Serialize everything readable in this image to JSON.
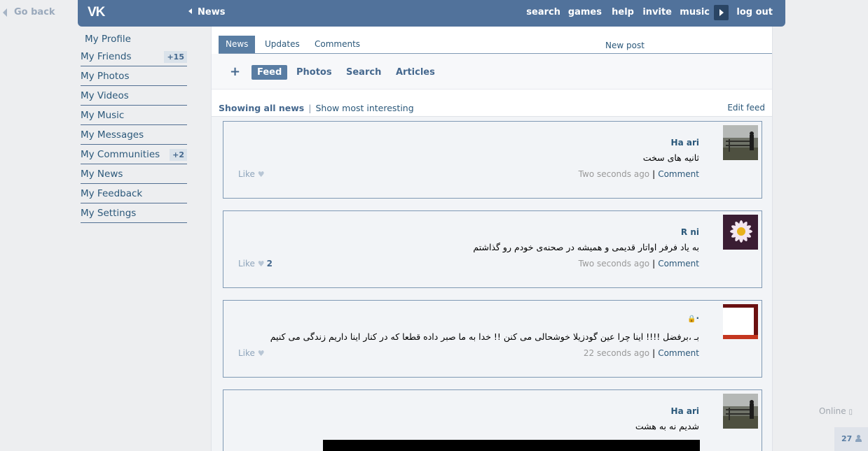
{
  "goback": "Go back",
  "header": {
    "logo": "VK",
    "back_label": "News",
    "nav": {
      "search": "search",
      "games": "games",
      "help": "help",
      "invite": "invite",
      "music": "music",
      "logout": "log out"
    }
  },
  "leftmenu": {
    "items": [
      {
        "label": "My Profile"
      },
      {
        "label": "My Friends",
        "badge": "+15"
      },
      {
        "label": "My Photos"
      },
      {
        "label": "My Videos"
      },
      {
        "label": "My Music"
      },
      {
        "label": "My Messages"
      },
      {
        "label": "My Communities",
        "badge": "+2"
      },
      {
        "label": "My News"
      },
      {
        "label": "My Feedback"
      },
      {
        "label": "My Settings"
      }
    ]
  },
  "tabs": {
    "news": "News",
    "updates": "Updates",
    "comments": "Comments",
    "new_post": "New post"
  },
  "subbar": {
    "plus": "+",
    "feed": "Feed",
    "photos": "Photos",
    "search": "Search",
    "articles": "Articles"
  },
  "filter": {
    "showing_all": "Showing all news",
    "sep": "|",
    "most_interesting": "Show most interesting",
    "edit_feed": "Edit feed"
  },
  "posts": [
    {
      "author": "Ha                    ari",
      "text": "ثانیه های سخت",
      "like": "Like",
      "like_count": "",
      "time": "Two seconds ago",
      "comment": "Comment"
    },
    {
      "author": "R                      ni",
      "text": "به یاد فرفر اواتار قدیمی و همیشه در صحنه‌ی خودم رو گذاشتم",
      "like": "Like",
      "like_count": "2",
      "time": "Two seconds ago",
      "comment": "Comment"
    },
    {
      "author": "·",
      "text": "بـ ،برفضل !!!! اینا چرا عین گودزیلا خوشحالی می کنن !! خدا به ما صبر داده قطعا که در کنار اینا داریم زندگی می کنیم",
      "like": "Like",
      "like_count": "",
      "time": "22 seconds ago",
      "comment": "Comment"
    },
    {
      "author": "Ha                    ari",
      "text": "شدیم نه به هشت"
    }
  ],
  "status": {
    "online": "Online",
    "online_count": "27"
  },
  "colors": {
    "header": "#51729b",
    "accent": "#597da3",
    "link": "#2b587a"
  }
}
